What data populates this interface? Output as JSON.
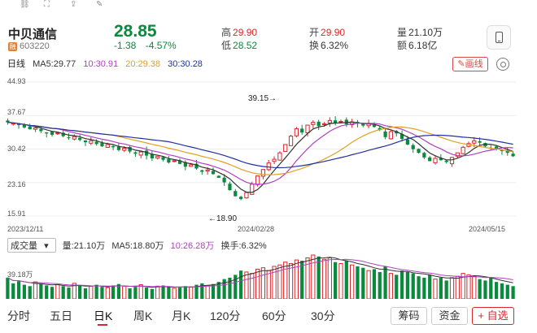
{
  "toolbar": {
    "icons": [
      "link-icon",
      "expand-icon",
      "share-icon",
      "tools-icon"
    ]
  },
  "stock": {
    "name": "中贝通信",
    "code": "603220",
    "badge": "融",
    "price": "28.85",
    "change": "-1.38",
    "change_pct": "-4.57%"
  },
  "stats": {
    "high_label": "高",
    "high": "29.90",
    "low_label": "低",
    "low": "28.52",
    "open_label": "开",
    "open": "29.90",
    "turnover_label": "换",
    "turnover": "6.32%",
    "volume_label": "量",
    "volume": "21.10万",
    "amount_label": "额",
    "amount": "6.18亿"
  },
  "ma_legend": {
    "period": "日线",
    "ma5": "MA5:29.77",
    "ma10": "10:30.91",
    "ma20": "20:29.38",
    "ma30": "30:30.28"
  },
  "draw_button": "画线",
  "colors": {
    "up": "#d8262c",
    "down": "#0a8a3c",
    "ma5": "#333333",
    "ma10": "#b040c0",
    "ma20": "#e0a020",
    "ma30": "#2030a0"
  },
  "chart_data": {
    "type": "candlestick",
    "y_ticks": [
      "44.93",
      "37.67",
      "30.42",
      "23.16",
      "15.91"
    ],
    "x_ticks": [
      "2023/12/11",
      "2024/02/28",
      "2024/05/15"
    ],
    "ylim": [
      15.91,
      44.93
    ],
    "annotations": [
      {
        "text": "39.15→",
        "value": 39.15
      },
      {
        "text": "←18.90",
        "value": 18.9
      }
    ],
    "closes": [
      36.2,
      36.0,
      35.6,
      35.1,
      34.7,
      35.0,
      34.3,
      33.8,
      33.5,
      33.9,
      33.2,
      32.8,
      33.1,
      32.4,
      31.9,
      32.2,
      31.5,
      31.0,
      31.4,
      30.8,
      30.2,
      30.6,
      29.9,
      29.4,
      29.8,
      29.0,
      28.4,
      28.8,
      28.1,
      27.5,
      27.9,
      27.2,
      26.6,
      27.0,
      26.2,
      25.5,
      25.9,
      25.0,
      24.2,
      23.2,
      21.5,
      20.2,
      19.6,
      21.0,
      22.8,
      24.6,
      26.0,
      27.4,
      28.2,
      29.6,
      31.4,
      33.2,
      34.8,
      34.0,
      35.6,
      36.2,
      35.4,
      35.9,
      36.6,
      36.1,
      36.4,
      35.8,
      36.3,
      35.9,
      35.5,
      35.9,
      35.2,
      34.6,
      33.0,
      34.2,
      33.8,
      32.6,
      31.4,
      30.4,
      29.6,
      28.6,
      27.8,
      28.4,
      28.0,
      27.6,
      28.6,
      29.6,
      30.8,
      31.6,
      32.2,
      31.8,
      31.0,
      30.6,
      30.4,
      30.0,
      29.6,
      28.85
    ],
    "volume": {
      "label": "成交量",
      "vol": "量:21.10万",
      "ma5": "MA5:18.80万",
      "ma10": "10:26.28万",
      "turnover": "换手:6.32%",
      "y_tick": "39.18万",
      "values": [
        30,
        22,
        25,
        20,
        18,
        24,
        21,
        19,
        17,
        20,
        18,
        16,
        22,
        19,
        15,
        18,
        20,
        17,
        16,
        19,
        21,
        18,
        15,
        17,
        20,
        16,
        14,
        18,
        19,
        17,
        15,
        16,
        18,
        17,
        20,
        22,
        19,
        21,
        24,
        28,
        30,
        34,
        40,
        38,
        36,
        42,
        44,
        40,
        46,
        48,
        52,
        50,
        55,
        54,
        58,
        62,
        60,
        56,
        58,
        52,
        50,
        54,
        48,
        46,
        44,
        40,
        42,
        38,
        46,
        36,
        34,
        40,
        38,
        36,
        32,
        30,
        34,
        28,
        30,
        26,
        30,
        32,
        36,
        34,
        32,
        28,
        26,
        30,
        24,
        22,
        20,
        18
      ]
    }
  },
  "tabs": [
    "分时",
    "五日",
    "日K",
    "周K",
    "月K",
    "120分",
    "60分",
    "30分"
  ],
  "active_tab": "日K",
  "buttons": {
    "chouma": "筹码",
    "zijin": "资金",
    "add": "+ 自选"
  }
}
